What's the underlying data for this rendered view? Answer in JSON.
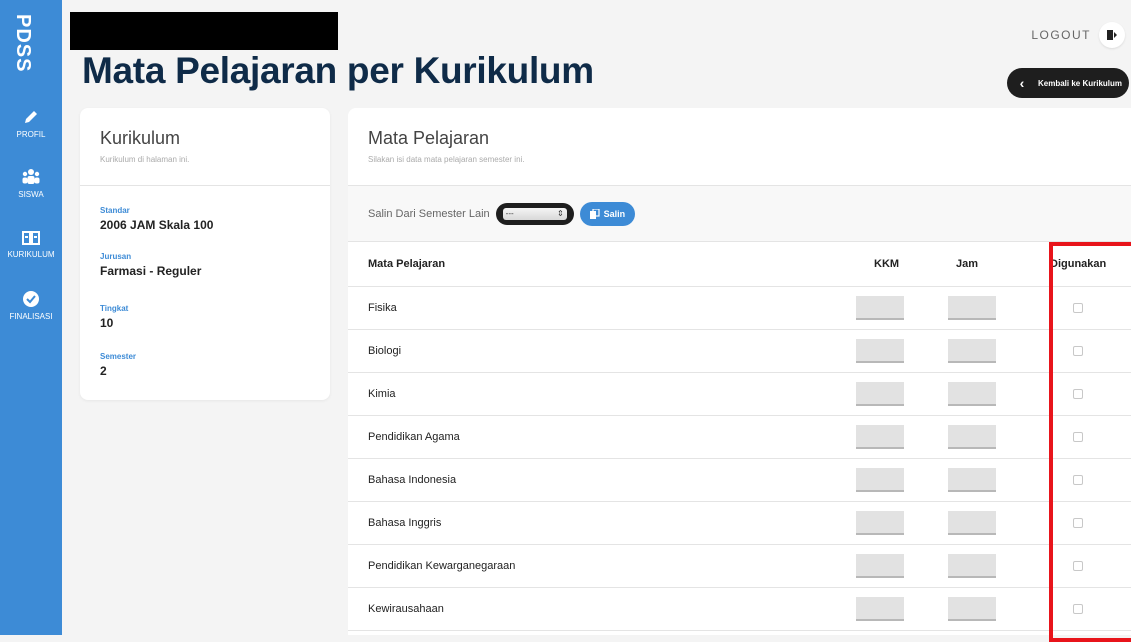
{
  "app": {
    "brand": "PDSS"
  },
  "sidebar": {
    "items": [
      {
        "label": "PROFIL",
        "icon": "pencil-icon"
      },
      {
        "label": "SISWA",
        "icon": "users-icon"
      },
      {
        "label": "KURIKULUM",
        "icon": "book-icon"
      },
      {
        "label": "FINALISASI",
        "icon": "check-circle-icon"
      }
    ]
  },
  "header": {
    "title": "Mata Pelajaran per Kurikulum",
    "logout_label": "LOGOUT",
    "back_label": "Kembali ke Kurikulum"
  },
  "kurikulum": {
    "title": "Kurikulum",
    "subtitle": "Kurikulum di halaman ini.",
    "fields": [
      {
        "key": "Standar",
        "value": "2006 JAM Skala 100"
      },
      {
        "key": "Jurusan",
        "value": "Farmasi - Reguler"
      },
      {
        "key": "Tingkat",
        "value": "10"
      },
      {
        "key": "Semester",
        "value": "2"
      }
    ]
  },
  "mapel": {
    "title": "Mata Pelajaran",
    "subtitle": "Silakan isi data mata pelajaran semester ini.",
    "copy_label": "Salin Dari Semester Lain",
    "copy_select_value": "---",
    "copy_button": "Salin",
    "columns": [
      "Mata Pelajaran",
      "KKM",
      "Jam",
      "Digunakan"
    ],
    "rows": [
      {
        "name": "Fisika",
        "kkm": "",
        "jam": "",
        "used": false
      },
      {
        "name": "Biologi",
        "kkm": "",
        "jam": "",
        "used": false
      },
      {
        "name": "Kimia",
        "kkm": "",
        "jam": "",
        "used": false
      },
      {
        "name": "Pendidikan Agama",
        "kkm": "",
        "jam": "",
        "used": false
      },
      {
        "name": "Bahasa Indonesia",
        "kkm": "",
        "jam": "",
        "used": false
      },
      {
        "name": "Bahasa Inggris",
        "kkm": "",
        "jam": "",
        "used": false
      },
      {
        "name": "Pendidikan Kewarganegaraan",
        "kkm": "",
        "jam": "",
        "used": false
      },
      {
        "name": "Kewirausahaan",
        "kkm": "",
        "jam": "",
        "used": false
      }
    ]
  },
  "colors": {
    "accent": "#3d8bd6",
    "title": "#0f2b48",
    "highlight": "#e8141b"
  }
}
